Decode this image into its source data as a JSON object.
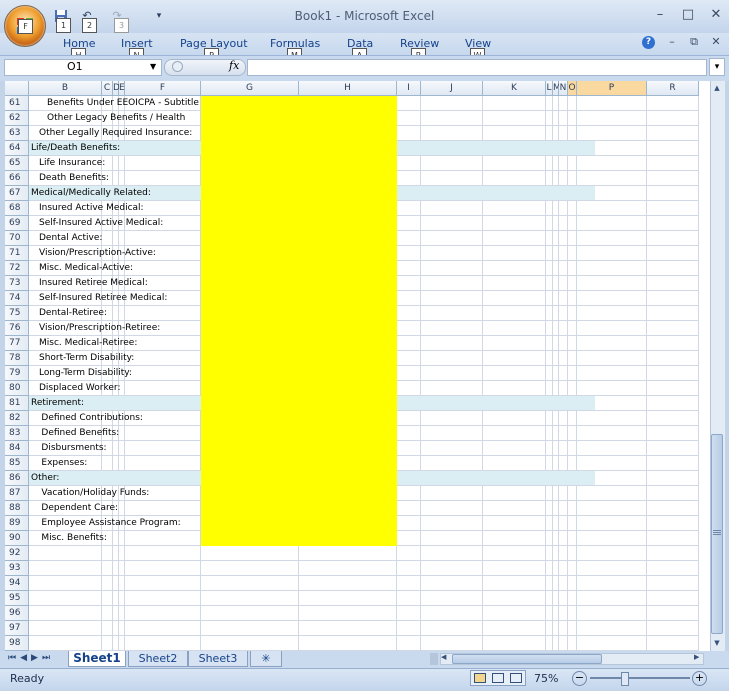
{
  "window": {
    "title": "Book1 - Microsoft Excel"
  },
  "qat": {
    "keytips": [
      "1",
      "2",
      "3"
    ]
  },
  "ribbon": {
    "tabs": [
      {
        "label": "Home",
        "keytip": "H"
      },
      {
        "label": "Insert",
        "keytip": "N"
      },
      {
        "label": "Page Layout",
        "keytip": "P"
      },
      {
        "label": "Formulas",
        "keytip": "M"
      },
      {
        "label": "Data",
        "keytip": "A"
      },
      {
        "label": "Review",
        "keytip": "R"
      },
      {
        "label": "View",
        "keytip": "W"
      }
    ],
    "office_keytip": "F"
  },
  "formula_bar": {
    "name_box": "O1",
    "fx": "fx",
    "value": ""
  },
  "columns": [
    "B",
    "C",
    "D",
    "E",
    "F",
    "G",
    "H",
    "I",
    "J",
    "K",
    "L",
    "M",
    "N",
    "O",
    "P",
    "R"
  ],
  "rows": [
    {
      "num": "61",
      "text": "Benefits Under EEOICPA - Subtitle",
      "indent": 2,
      "band": false
    },
    {
      "num": "62",
      "text": "Other Legacy Benefits / Health",
      "indent": 2,
      "band": false
    },
    {
      "num": "63",
      "text": "Other Legally Required Insurance:",
      "indent": 1,
      "band": false
    },
    {
      "num": "64",
      "text": "Life/Death Benefits:",
      "indent": 0,
      "band": true
    },
    {
      "num": "65",
      "text": "Life Insurance:",
      "indent": 1,
      "band": false
    },
    {
      "num": "66",
      "text": "Death Benefits:",
      "indent": 1,
      "band": false
    },
    {
      "num": "67",
      "text": "Medical/Medically Related:",
      "indent": 0,
      "band": true
    },
    {
      "num": "68",
      "text": "Insured Active Medical:",
      "indent": 1,
      "band": false
    },
    {
      "num": "69",
      "text": "Self-Insured Active Medical:",
      "indent": 1,
      "band": false
    },
    {
      "num": "70",
      "text": "Dental Active:",
      "indent": 1,
      "band": false
    },
    {
      "num": "71",
      "text": "Vision/Prescription-Active:",
      "indent": 1,
      "band": false
    },
    {
      "num": "72",
      "text": "Misc. Medical-Active:",
      "indent": 1,
      "band": false
    },
    {
      "num": "73",
      "text": "Insured Retiree Medical:",
      "indent": 1,
      "band": false
    },
    {
      "num": "74",
      "text": "Self-Insured Retiree Medical:",
      "indent": 1,
      "band": false
    },
    {
      "num": "75",
      "text": "Dental-Retiree:",
      "indent": 1,
      "band": false
    },
    {
      "num": "76",
      "text": "Vision/Prescription-Retiree:",
      "indent": 1,
      "band": false
    },
    {
      "num": "77",
      "text": "Misc. Medical-Retiree:",
      "indent": 1,
      "band": false
    },
    {
      "num": "78",
      "text": "Short-Term Disability:",
      "indent": 1,
      "band": false
    },
    {
      "num": "79",
      "text": "Long-Term Disability:",
      "indent": 1,
      "band": false
    },
    {
      "num": "80",
      "text": "Displaced Worker:",
      "indent": 1,
      "band": false
    },
    {
      "num": "81",
      "text": "Retirement:",
      "indent": 0,
      "band": true
    },
    {
      "num": "82",
      "text": "Defined Contributions:",
      "indent": 1.3,
      "band": false
    },
    {
      "num": "83",
      "text": "Defined Benefits:",
      "indent": 1.3,
      "band": false
    },
    {
      "num": "84",
      "text": "Disbursments:",
      "indent": 1.3,
      "band": false
    },
    {
      "num": "85",
      "text": "Expenses:",
      "indent": 1.3,
      "band": false
    },
    {
      "num": "86",
      "text": "Other:",
      "indent": 0,
      "band": true
    },
    {
      "num": "87",
      "text": "Vacation/Holiday Funds:",
      "indent": 1.3,
      "band": false
    },
    {
      "num": "88",
      "text": "Dependent Care:",
      "indent": 1.3,
      "band": false
    },
    {
      "num": "89",
      "text": "Employee Assistance Program:",
      "indent": 1.3,
      "band": false
    },
    {
      "num": "90",
      "text": "Misc. Benefits:",
      "indent": 1.3,
      "band": false
    },
    {
      "num": "92",
      "text": "",
      "indent": 0,
      "band": false
    },
    {
      "num": "93",
      "text": "",
      "indent": 0,
      "band": false
    },
    {
      "num": "94",
      "text": "",
      "indent": 0,
      "band": false
    },
    {
      "num": "95",
      "text": "",
      "indent": 0,
      "band": false
    },
    {
      "num": "96",
      "text": "",
      "indent": 0,
      "band": false
    },
    {
      "num": "97",
      "text": "",
      "indent": 0,
      "band": false
    },
    {
      "num": "98",
      "text": "",
      "indent": 0,
      "band": false
    }
  ],
  "sheets": [
    "Sheet1",
    "Sheet2",
    "Sheet3"
  ],
  "status": {
    "text": "Ready",
    "zoom": "75%"
  },
  "colors": {
    "highlight": "#ffff00",
    "band": "#dbeef3",
    "selected_col": "#f9d99f"
  }
}
